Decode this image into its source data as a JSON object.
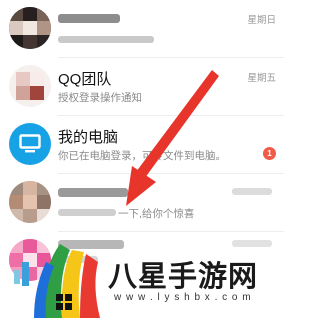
{
  "conversations": [
    {
      "title": "",
      "subtitle": "",
      "time": "星期日",
      "avatar": "pixelated-photo-dark"
    },
    {
      "title": "QQ团队",
      "subtitle": "授权登录操作通知",
      "time": "星期五",
      "avatar": "pixelated-photo-light"
    },
    {
      "title": "我的电脑",
      "subtitle": "你已在电脑登录，可传文件到电脑。",
      "time": "",
      "badge": "1",
      "avatar": "computer-icon"
    },
    {
      "title": "",
      "subtitle": "一下,给你个惊喜",
      "time": "",
      "avatar": "pixelated-photo-face"
    },
    {
      "title": "",
      "subtitle": "",
      "time": "",
      "avatar": "pixelated-photo-pink"
    }
  ],
  "watermark": {
    "text": "八星手游网",
    "url": "w w w . l y s h b x . c o m",
    "logo": "colorful-logo-icon"
  },
  "colors": {
    "computer_blue": "#17a2e5",
    "badge_red": "#f05b48",
    "arrow_red": "#e8352b"
  }
}
